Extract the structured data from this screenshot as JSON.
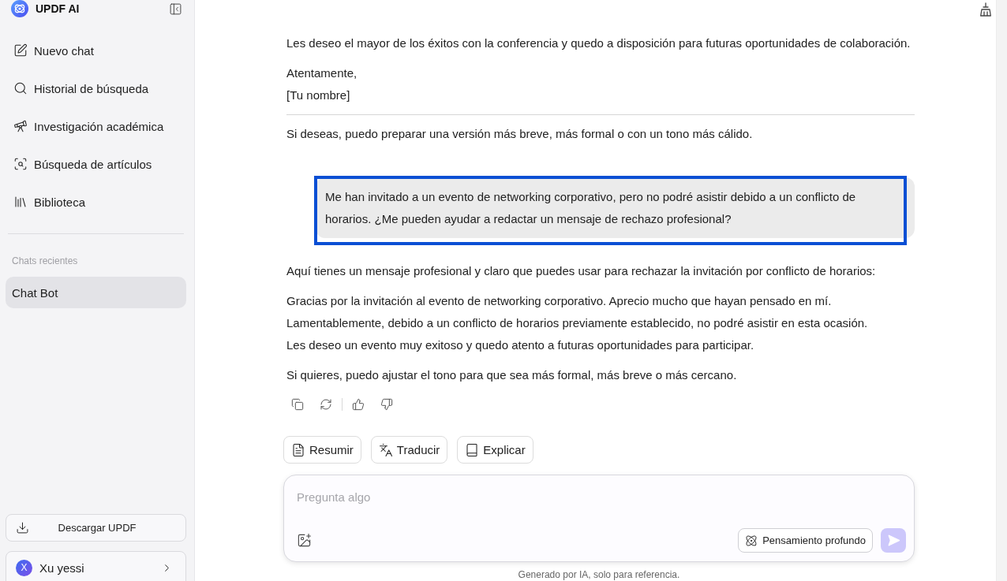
{
  "sidebar": {
    "logo_text": "UPDF AI",
    "nav_items": [
      {
        "label": "Nuevo chat"
      },
      {
        "label": "Historial de búsqueda"
      },
      {
        "label": "Investigación académica"
      },
      {
        "label": "Búsqueda de artículos"
      },
      {
        "label": "Biblioteca"
      }
    ],
    "section_title": "Chats recientes",
    "recent_chats": [
      {
        "label": "Chat Bot",
        "selected": true
      }
    ],
    "download_button": "Descargar UPDF",
    "user": {
      "initial": "X",
      "name": "Xu yessi"
    }
  },
  "conversation": [
    {
      "kind": "assistant",
      "blocks": [
        {
          "kind": "paragraph",
          "text": "Les deseo el mayor de los éxitos con la conferencia y quedo a disposición para futuras oportunidades de colaboración."
        },
        {
          "kind": "lines",
          "lines": [
            "Atentamente,",
            "[Tu nombre]"
          ]
        },
        {
          "kind": "rule"
        },
        {
          "kind": "paragraph",
          "text": "Si deseas, puedo preparar una versión más breve, más formal o con un tono más cálido."
        }
      ]
    },
    {
      "kind": "user",
      "highlighted": true,
      "text": "Me han invitado a un evento de networking corporativo, pero no podré asistir debido a un conflicto de horarios. ¿Me pueden ayudar a redactar un mensaje de rechazo profesional?"
    },
    {
      "kind": "assistant",
      "blocks": [
        {
          "kind": "paragraph",
          "text": "Aquí tienes un mensaje profesional y claro que puedes usar para rechazar la invitación por conflicto de horarios:"
        },
        {
          "kind": "lines",
          "lines": [
            "Gracias por la invitación al evento de networking corporativo. Aprecio mucho que hayan pensado en mí.",
            "Lamentablemente, debido a un conflicto de horarios previamente establecido, no podré asistir en esta ocasión.",
            "Les deseo un evento muy exitoso y quedo atento a futuras oportunidades para participar."
          ]
        },
        {
          "kind": "paragraph",
          "text": "Si quieres, puedo ajustar el tono para que sea más formal, más breve o más cercano."
        }
      ]
    }
  ],
  "quick_actions": [
    {
      "label": "Resumir"
    },
    {
      "label": "Traducir"
    },
    {
      "label": "Explicar"
    }
  ],
  "composer": {
    "placeholder": "Pregunta algo",
    "deep_thinking": {
      "label": "Pensamiento profundo",
      "on": false
    },
    "send_button": {
      "disabled": true
    }
  },
  "footer_note": "Generado por IA, solo para referencia."
}
